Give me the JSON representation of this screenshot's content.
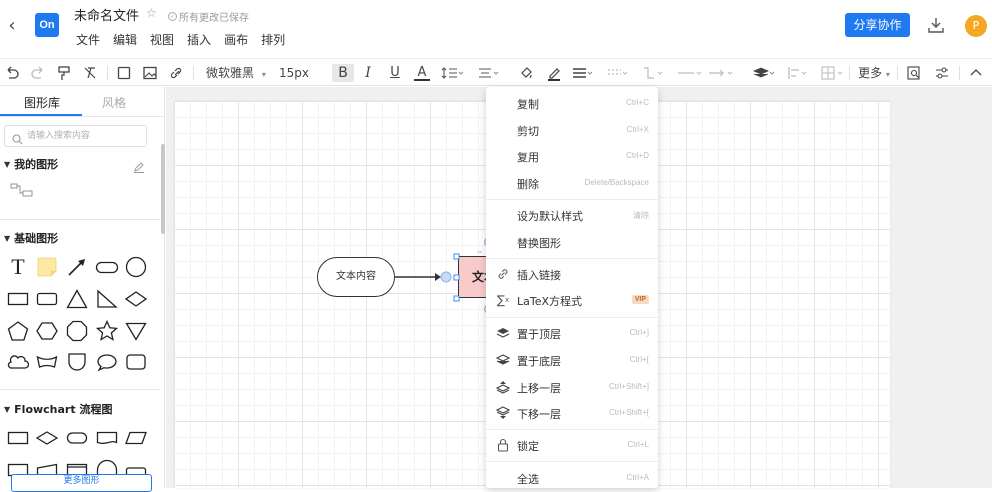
{
  "header": {
    "title": "未命名文件",
    "save_status": "所有更改已保存",
    "logo_text": "On",
    "menu": [
      "文件",
      "编辑",
      "视图",
      "插入",
      "画布",
      "排列"
    ],
    "share_label": "分享协作",
    "avatar_letter": "P",
    "brand_color": "#1f7af0",
    "avatar_color": "#f5a623"
  },
  "toolbar": {
    "font_family": "微软雅黑",
    "font_size": "15px",
    "bold": "B",
    "italic": "I",
    "underline": "U",
    "font_color": "A",
    "more_label": "更多"
  },
  "left_panel": {
    "tabs": [
      {
        "label": "图形库",
        "active": true
      },
      {
        "label": "风格",
        "active": false
      }
    ],
    "search_placeholder": "请输入搜索内容",
    "sections": [
      {
        "title": "我的图形"
      },
      {
        "title": "基础图形",
        "text_shape_label": "T"
      },
      {
        "title": "Flowchart 流程图"
      }
    ],
    "more_shapes_label": "更多图形"
  },
  "canvas": {
    "nodes": [
      {
        "label": "文本内容",
        "shape": "rounded-rect"
      },
      {
        "label": "文本",
        "shape": "rect",
        "fill": "#f8caca",
        "selected": true
      }
    ]
  },
  "context_menu": {
    "items": [
      {
        "label": "复制",
        "shortcut": "Ctrl+C",
        "icon": ""
      },
      {
        "label": "剪切",
        "shortcut": "Ctrl+X",
        "icon": ""
      },
      {
        "label": "复用",
        "shortcut": "Ctrl+D",
        "icon": ""
      },
      {
        "label": "删除",
        "shortcut": "Delete/Backspace",
        "icon": ""
      },
      {
        "label": "设为默认样式",
        "shortcut": "清除",
        "icon": ""
      },
      {
        "label": "替换图形",
        "shortcut": "",
        "icon": ""
      },
      {
        "label": "插入链接",
        "shortcut": "",
        "icon": "link-icon"
      },
      {
        "label": "LaTeX方程式",
        "badge": "VIP",
        "icon": "sigma-icon"
      },
      {
        "label": "置于顶层",
        "shortcut": "Ctrl+]",
        "icon": "layers-icon"
      },
      {
        "label": "置于底层",
        "shortcut": "Ctrl+[",
        "icon": "layers-icon"
      },
      {
        "label": "上移一层",
        "shortcut": "Ctrl+Shift+]",
        "icon": "layer-up-icon"
      },
      {
        "label": "下移一层",
        "shortcut": "Ctrl+Shift+[",
        "icon": "layer-down-icon"
      },
      {
        "label": "锁定",
        "shortcut": "Ctrl+L",
        "icon": "lock-icon"
      },
      {
        "label": "全选",
        "shortcut": "Ctrl+A",
        "icon": ""
      }
    ]
  }
}
